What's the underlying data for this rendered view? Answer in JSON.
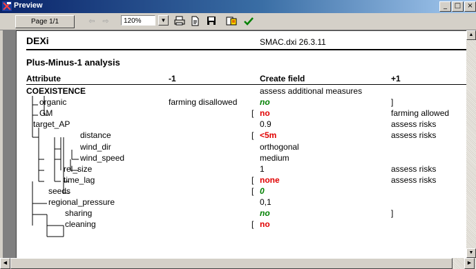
{
  "window": {
    "title": "Preview",
    "buttons": [
      "_",
      "□",
      "×"
    ]
  },
  "toolbar": {
    "page_label": "Page 1/1",
    "zoom": "120%",
    "icons": [
      "prev-page-icon",
      "next-page-icon",
      "print-icon",
      "page-setup-icon",
      "save-icon",
      "export-icon",
      "ok-check-icon"
    ]
  },
  "report": {
    "brand": "DEXi",
    "file": "SMAC.dxi 26.3.11",
    "section_title": "Plus-Minus-1 analysis",
    "headers": {
      "attribute": "Attribute",
      "minus": "-1",
      "value": "Create field",
      "plus": "+1"
    },
    "rows": [
      {
        "attr": "COEXISTENCE",
        "minus": "",
        "minus_bracket": "",
        "value": "assess additional measures",
        "value_style": "normal",
        "plus": "",
        "plus_bracket": ""
      },
      {
        "attr": "organic",
        "minus": "farming disallowed",
        "minus_bracket": "",
        "value": "no",
        "value_style": "green",
        "plus": "",
        "plus_bracket": "]"
      },
      {
        "attr": "GM",
        "minus": "",
        "minus_bracket": "[",
        "value": "no",
        "value_style": "red",
        "plus": "farming allowed",
        "plus_bracket": ""
      },
      {
        "attr": "target_AP",
        "minus": "",
        "minus_bracket": "",
        "value": "0.9",
        "value_style": "normal",
        "plus": "assess risks",
        "plus_bracket": ""
      },
      {
        "attr": "distance",
        "minus": "",
        "minus_bracket": "[",
        "value": "<5m",
        "value_style": "red",
        "plus": "assess risks",
        "plus_bracket": ""
      },
      {
        "attr": "wind_dir",
        "minus": "",
        "minus_bracket": "",
        "value": "orthogonal",
        "value_style": "normal",
        "plus": "",
        "plus_bracket": ""
      },
      {
        "attr": "wind_speed",
        "minus": "",
        "minus_bracket": "",
        "value": "medium",
        "value_style": "normal",
        "plus": "",
        "plus_bracket": ""
      },
      {
        "attr": "rel_size",
        "minus": "",
        "minus_bracket": "",
        "value": "1",
        "value_style": "normal",
        "plus": "assess risks",
        "plus_bracket": ""
      },
      {
        "attr": "time_lag",
        "minus": "",
        "minus_bracket": "[",
        "value": "none",
        "value_style": "red",
        "plus": "assess risks",
        "plus_bracket": ""
      },
      {
        "attr": "seeds",
        "minus": "",
        "minus_bracket": "[",
        "value": "0",
        "value_style": "green",
        "plus": "",
        "plus_bracket": ""
      },
      {
        "attr": "regional_pressure",
        "minus": "",
        "minus_bracket": "",
        "value": "0,1",
        "value_style": "normal",
        "plus": "",
        "plus_bracket": ""
      },
      {
        "attr": "sharing",
        "minus": "",
        "minus_bracket": "",
        "value": "no",
        "value_style": "green",
        "plus": "",
        "plus_bracket": "]"
      },
      {
        "attr": "cleaning",
        "minus": "",
        "minus_bracket": "[",
        "value": "no",
        "value_style": "red",
        "plus": "",
        "plus_bracket": ""
      }
    ]
  },
  "colors": {
    "red": "#e00000",
    "green": "#008000",
    "title_bar": "#0a246a"
  }
}
